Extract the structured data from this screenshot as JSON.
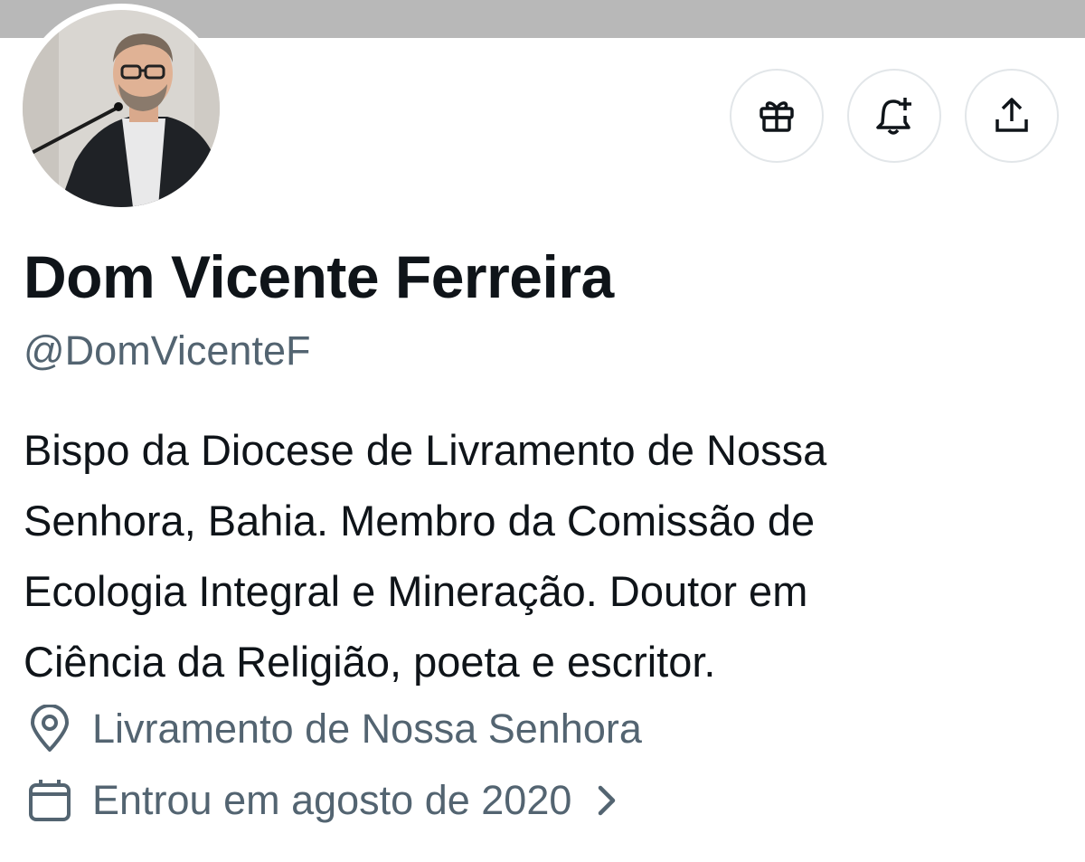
{
  "profile": {
    "display_name": "Dom Vicente Ferreira",
    "handle": "@DomVicenteF",
    "bio_lines": [
      "Bispo da Diocese de Livramento de Nossa",
      "Senhora, Bahia. Membro da Comissão de",
      "Ecologia Integral e Mineração. Doutor em",
      "Ciência da Religião, poeta e escritor."
    ],
    "location": "Livramento de Nossa Senhora",
    "joined": "Entrou em agosto de 2020"
  },
  "actions": {
    "gift_icon": "gift-icon",
    "notify_icon": "bell-plus-icon",
    "share_icon": "share-upload-icon"
  },
  "colors": {
    "text_primary": "#0f1419",
    "text_secondary": "#536471",
    "button_border": "#e2e6e9",
    "banner": "#b8b8b8"
  }
}
